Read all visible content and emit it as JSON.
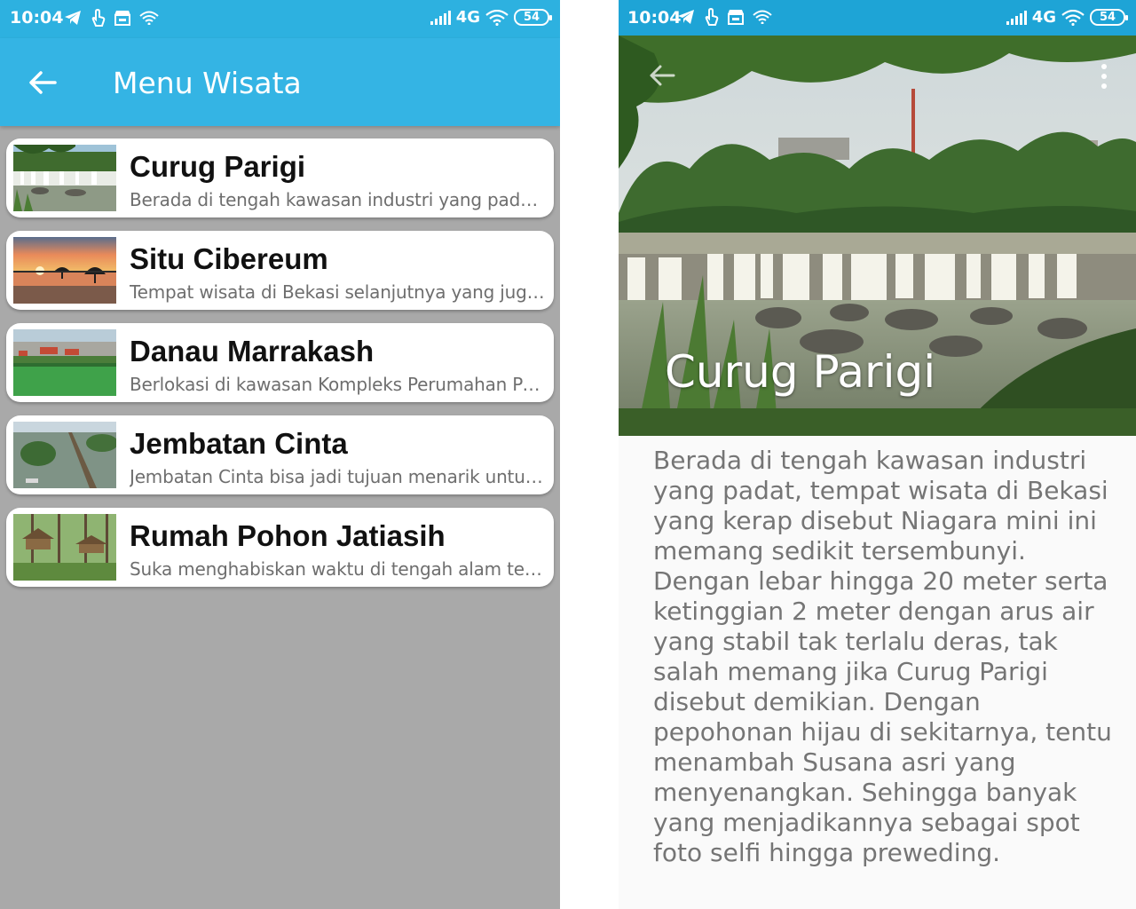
{
  "colors": {
    "status_bar": "#2db1e0",
    "app_bar": "#34b4e4",
    "list_background": "#a9a9a9",
    "card": "#ffffff"
  },
  "status_left": {
    "time": "10:04",
    "network": "4G",
    "battery": "54",
    "icons": [
      "telegram-icon",
      "touch-icon",
      "store-icon",
      "wifi-icon"
    ]
  },
  "status_right": {
    "time": "10:04",
    "network": "4G",
    "battery": "54",
    "icons": [
      "telegram-icon",
      "touch-icon",
      "store-icon",
      "wifi-icon"
    ]
  },
  "list_screen": {
    "title": "Menu Wisata",
    "back_icon": "arrow-back-icon",
    "items": [
      {
        "title": "Curug Parigi",
        "desc": "Berada di tengah kawasan industri yang padat, tempat wisata di Bekasi",
        "thumb": "waterfall-thumb"
      },
      {
        "title": "Situ Cibereum",
        "desc": "Tempat wisata di Bekasi selanjutnya yang juga masuk daftar",
        "thumb": "sunset-lake-thumb"
      },
      {
        "title": "Danau Marrakash",
        "desc": "Berlokasi di kawasan Kompleks Perumahan Pesona",
        "thumb": "lake-town-thumb"
      },
      {
        "title": "Jembatan Cinta",
        "desc": "Jembatan Cinta bisa jadi tujuan menarik untuk santai",
        "thumb": "bridge-thumb"
      },
      {
        "title": "Rumah Pohon Jatiasih",
        "desc": "Suka menghabiskan waktu di tengah alam terbuka",
        "thumb": "treehouse-thumb"
      }
    ]
  },
  "detail_screen": {
    "title": "Curug Parigi",
    "back_icon": "arrow-back-icon",
    "menu_icon": "more-vert-icon",
    "description": "Berada di tengah kawasan industri yang padat, tempat wisata di Bekasi yang kerap disebut Niagara mini ini memang sedikit tersembunyi. Dengan lebar hingga 20 meter serta ketinggian 2 meter dengan arus air yang stabil tak terlalu deras, tak salah memang jika Curug Parigi disebut demikian. Dengan pepohonan hijau di sekitarnya, tentu menambah Susana asri yang menyenangkan. Sehingga banyak yang menjadikannya sebagai spot foto selfi hingga preweding."
  }
}
